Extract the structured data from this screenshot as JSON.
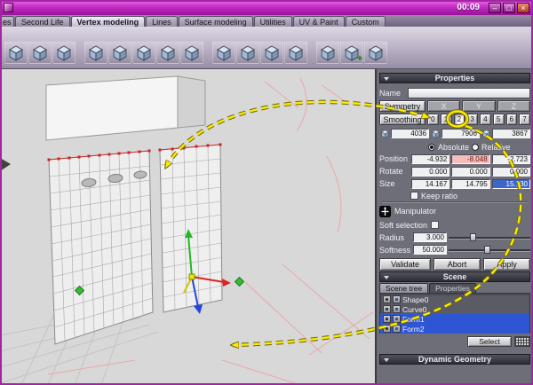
{
  "window": {
    "time": "00:09",
    "controls": {
      "minimize": "–",
      "maximize": "□",
      "close": "×"
    }
  },
  "tab_bar": {
    "tabs": [
      {
        "label": "es"
      },
      {
        "label": "Second Life"
      },
      {
        "label": "Vertex modeling"
      },
      {
        "label": "Lines"
      },
      {
        "label": "Surface modeling"
      },
      {
        "label": "Utilities"
      },
      {
        "label": "UV & Paint"
      },
      {
        "label": "Custom"
      }
    ],
    "active_tab": "Vertex modeling"
  },
  "properties": {
    "title": "Properties",
    "name": {
      "label": "Name",
      "value": ""
    },
    "symmetry": {
      "label": "Symmetry",
      "axes": [
        "X",
        "Y",
        "Z"
      ]
    },
    "smoothing": {
      "label": "Smoothing",
      "levels": [
        "0",
        "1",
        "2",
        "3",
        "4",
        "5",
        "6",
        "7"
      ],
      "active_level": "2"
    },
    "counts": {
      "vertices": "4036",
      "edges": "7906",
      "faces": "3867"
    },
    "coord_mode": {
      "absolute": "Absolute",
      "relative": "Relative",
      "selected": "Absolute"
    },
    "position": {
      "label": "Position",
      "values": [
        "-4.932",
        "-8.048",
        "-2.723"
      ]
    },
    "rotate": {
      "label": "Rotate",
      "values": [
        "0.000",
        "0.000",
        "0.000"
      ]
    },
    "size": {
      "label": "Size",
      "values": [
        "14.167",
        "14.795",
        "15.130"
      ]
    },
    "keep_ratio": {
      "label": "Keep ratio",
      "checked": false
    },
    "manipulator": {
      "label": "Manipulator"
    },
    "soft_selection": {
      "label": "Soft selection",
      "checked": false
    },
    "radius": {
      "label": "Radius",
      "value": "3.000"
    },
    "softness": {
      "label": "Softness",
      "value": "50.000"
    },
    "actions": {
      "validate": "Validate",
      "abort": "Abort",
      "apply": "Apply"
    }
  },
  "scene": {
    "title": "Scene",
    "tabs": [
      {
        "label": "Scene tree"
      },
      {
        "label": "Properties"
      }
    ],
    "active_tab": "Scene tree",
    "items": [
      {
        "label": "Shape0",
        "selected": false
      },
      {
        "label": "Curve0",
        "selected": false
      },
      {
        "label": "Form1",
        "selected": true
      },
      {
        "label": "Form2",
        "selected": true
      }
    ],
    "select_button": "Select"
  },
  "dynamic_geometry": {
    "title": "Dynamic Geometry"
  },
  "annotation": {
    "arrow_color": "#ffe900",
    "circled_control": "smoothing-level-2"
  }
}
